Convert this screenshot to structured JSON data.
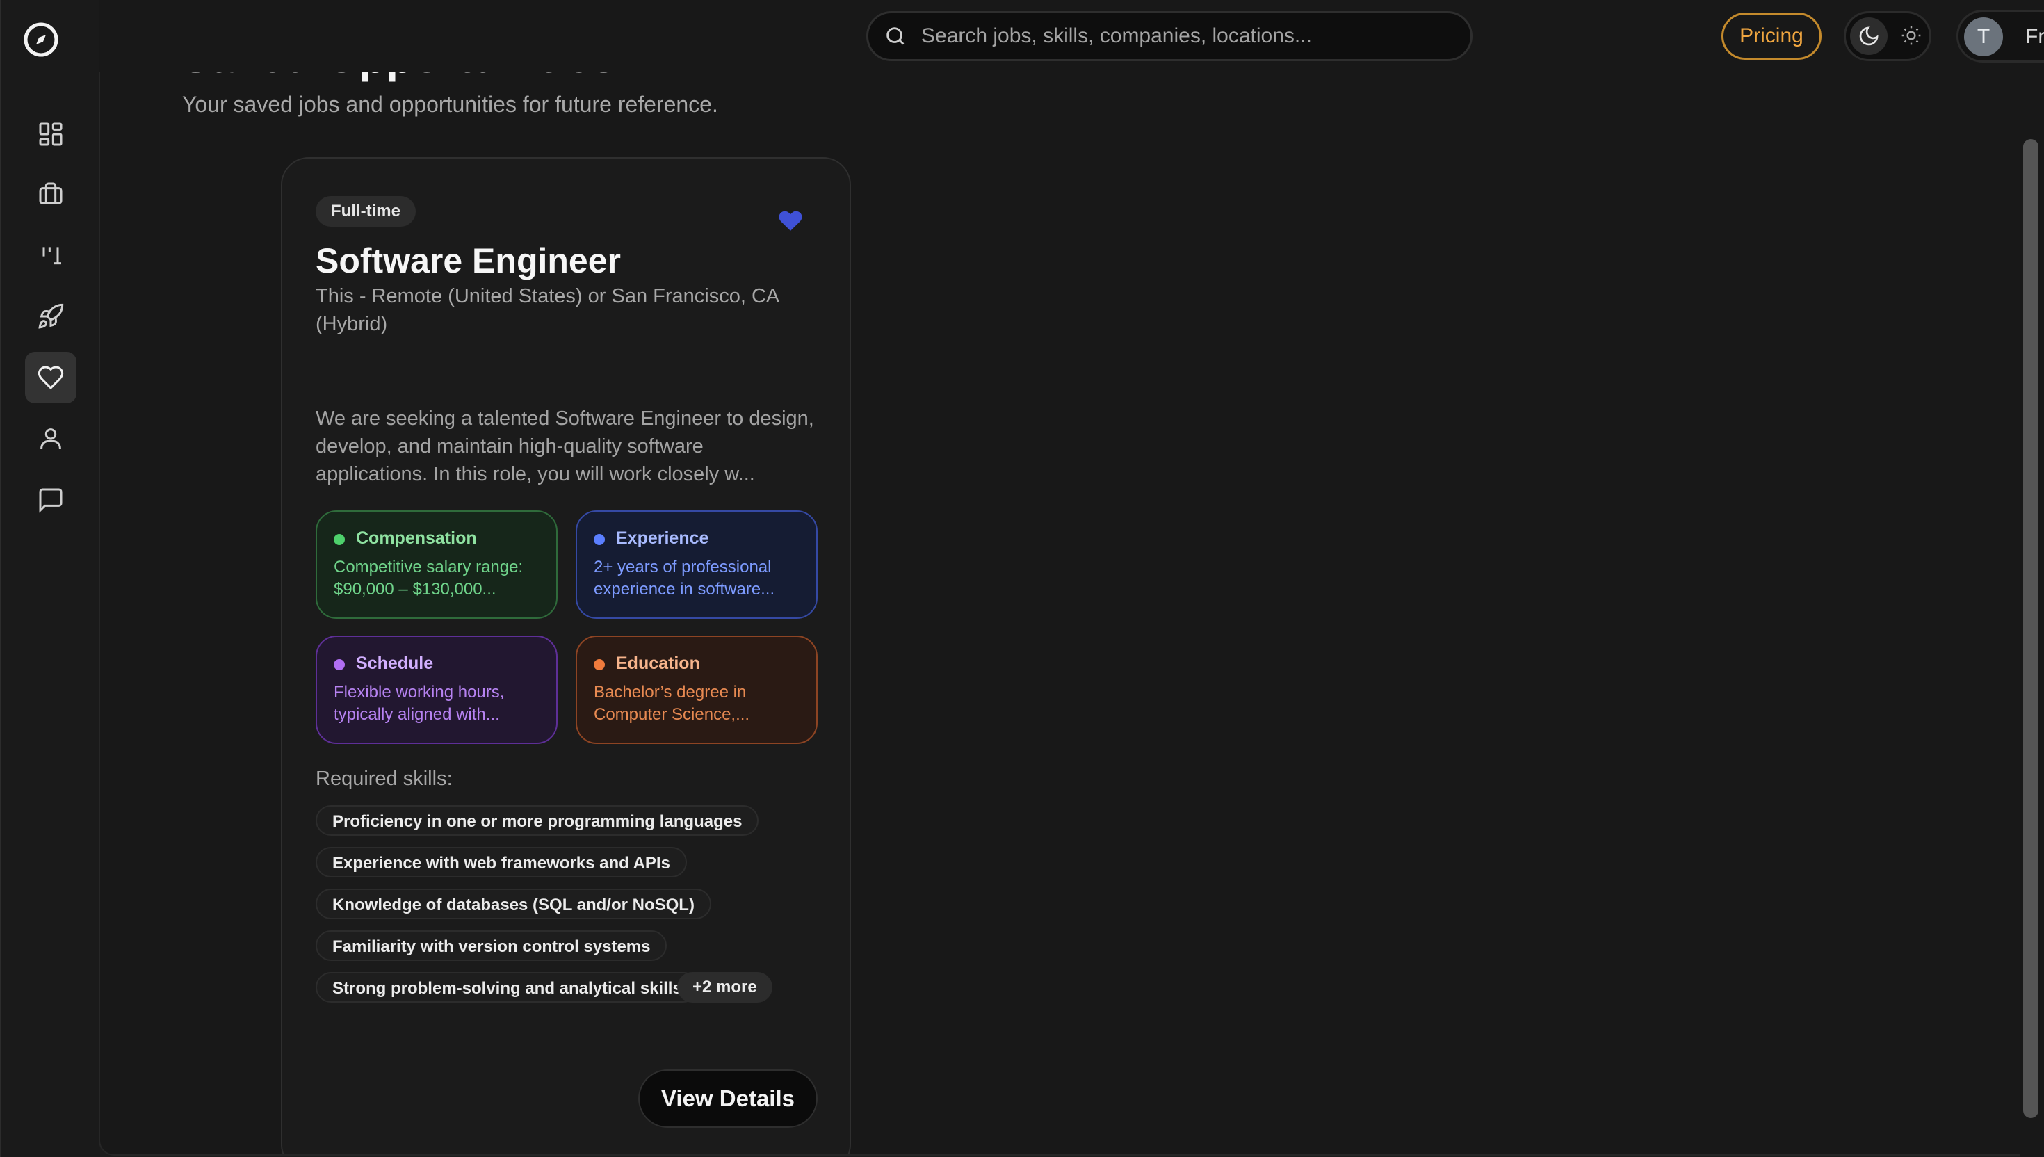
{
  "header": {
    "page_title": "Saved Opportunities",
    "page_subtitle": "Your saved jobs and opportunities for future reference."
  },
  "topbar": {
    "search_placeholder": "Search jobs, skills, companies, locations...",
    "pricing_label": "Pricing",
    "avatar_initial": "T",
    "plan_label": "Free"
  },
  "sidebar": {
    "items": [
      {
        "name": "dashboard",
        "icon": "grid-icon",
        "active": false
      },
      {
        "name": "jobs",
        "icon": "briefcase-icon",
        "active": false
      },
      {
        "name": "tracker",
        "icon": "columns-icon",
        "active": false
      },
      {
        "name": "launch",
        "icon": "rocket-icon",
        "active": false
      },
      {
        "name": "saved",
        "icon": "heart-icon",
        "active": true
      },
      {
        "name": "profile",
        "icon": "user-icon",
        "active": false
      },
      {
        "name": "messages",
        "icon": "chat-icon",
        "active": false
      }
    ]
  },
  "card": {
    "badge": "Full-time",
    "title": "Software Engineer",
    "location": "This - Remote (United States) or San Francisco, CA (Hybrid)",
    "description": "We are seeking a talented Software Engineer to design, develop, and maintain high-quality software applications. In this role, you will work closely w...",
    "tiles": {
      "compensation": {
        "label": "Compensation",
        "text": "Competitive salary range: $90,000 – $130,000..."
      },
      "experience": {
        "label": "Experience",
        "text": "2+ years of professional experience in software..."
      },
      "schedule": {
        "label": "Schedule",
        "text": "Flexible working hours, typically aligned with..."
      },
      "education": {
        "label": "Education",
        "text": "Bachelor’s degree in Computer Science,..."
      }
    },
    "skills_label": "Required skills:",
    "skills": [
      "Proficiency in one or more programming languages",
      "Experience with web frameworks and APIs",
      "Knowledge of databases (SQL and/or NoSQL)",
      "Familiarity with version control systems",
      "Strong problem-solving and analytical skills"
    ],
    "more_label": "+2 more",
    "details_label": "View Details"
  },
  "colors": {
    "accent_pricing": "#f0a640",
    "heart": "#3f51d6",
    "compensation": "#4ed16c",
    "experience": "#5b7fff",
    "schedule": "#b06ef2",
    "education": "#f07b3d"
  }
}
